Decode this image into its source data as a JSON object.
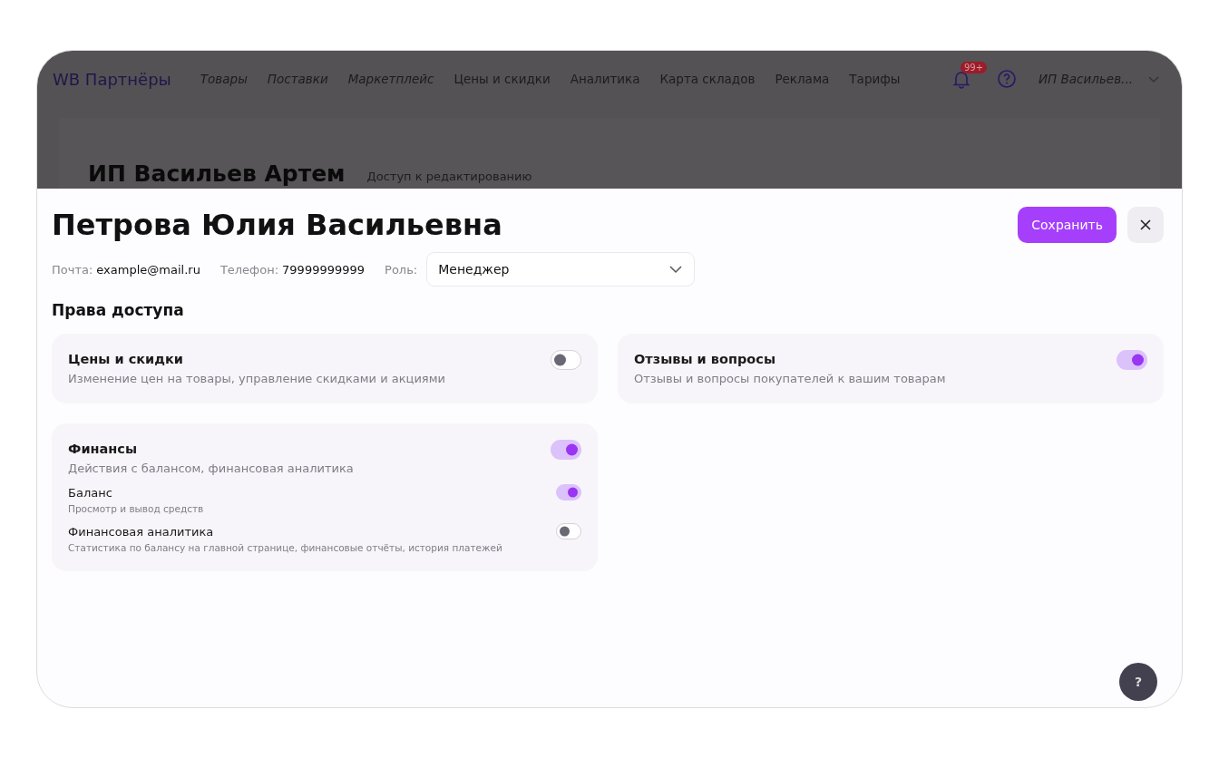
{
  "header": {
    "logo": "WB Партнёры",
    "nav": [
      {
        "label": "Товары",
        "italic": true
      },
      {
        "label": "Поставки",
        "italic": true
      },
      {
        "label": "Маркетплейс",
        "italic": true
      },
      {
        "label": "Цены и скидки",
        "italic": false
      },
      {
        "label": "Аналитика",
        "italic": false
      },
      {
        "label": "Карта складов",
        "italic": false
      },
      {
        "label": "Реклама",
        "italic": false
      },
      {
        "label": "Тарифы",
        "italic": false
      }
    ],
    "notifications_badge": "99+",
    "account": "ИП Васильев..."
  },
  "background_page": {
    "title": "ИП Васильев Артем",
    "subtitle": "Доступ к редактированию"
  },
  "sheet": {
    "title": "Петрова Юлия Васильевна",
    "save_button": "Сохранить",
    "fields": [
      {
        "label": "Почта:",
        "value": "example@mail.ru"
      },
      {
        "label": "Телефон:",
        "value": "79999999999"
      }
    ],
    "role": {
      "label": "Роль:",
      "value": "Менеджер"
    },
    "section_title": "Права доступа",
    "permissions": [
      {
        "title": "Цены и скидки",
        "description": "Изменение цен на товары, управление скидками и акциями",
        "on": false
      },
      {
        "title": "Отзывы и вопросы",
        "description": "Отзывы и вопросы покупателей к вашим товарам",
        "on": true
      },
      {
        "title": "Финансы",
        "description": "Действия с балансом, финансовая аналитика",
        "on": true,
        "children": [
          {
            "title": "Баланс",
            "description": "Просмотр и вывод средств",
            "on": true
          },
          {
            "title": "Финансовая аналитика",
            "description": "Статистика по балансу на главной странице, финансовые отчёты, история платежей",
            "on": false
          }
        ]
      }
    ]
  },
  "help_button": "?"
}
